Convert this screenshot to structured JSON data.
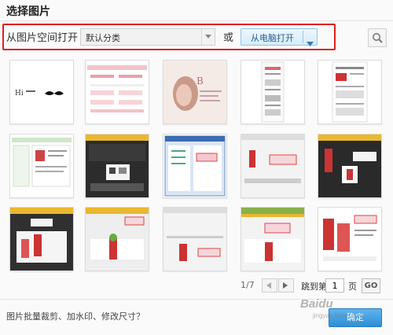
{
  "dialog": {
    "title": "选择图片"
  },
  "toolbar": {
    "source_label": "从图片空间打开",
    "category_select": {
      "selected": "默认分类"
    },
    "or_text": "或",
    "open_from_pc_label": "从电脑打开",
    "highlight_color": "#e02020"
  },
  "thumbnails": [
    {
      "kind": "logo"
    },
    {
      "kind": "page-pink"
    },
    {
      "kind": "portrait"
    },
    {
      "kind": "doc-narrow"
    },
    {
      "kind": "doc-wide"
    },
    {
      "kind": "page-green"
    },
    {
      "kind": "screen-dark"
    },
    {
      "kind": "screen-window"
    },
    {
      "kind": "screen-light"
    },
    {
      "kind": "screen-dark-red"
    },
    {
      "kind": "screen-dark-model"
    },
    {
      "kind": "screen-light-model"
    },
    {
      "kind": "screen-light-model2"
    },
    {
      "kind": "screen-green-model"
    },
    {
      "kind": "doc-red-models"
    }
  ],
  "pager": {
    "page_count": "1/7",
    "goto_prefix": "跳到第",
    "page_value": "1",
    "goto_suffix": "页",
    "go_label": "GO"
  },
  "footer": {
    "tip": "图片批量裁剪、加水印、修改尺寸？",
    "ok_label": "确定"
  },
  "watermark": {
    "text": "Baidu",
    "sub": "jingyan.baidu.com"
  }
}
